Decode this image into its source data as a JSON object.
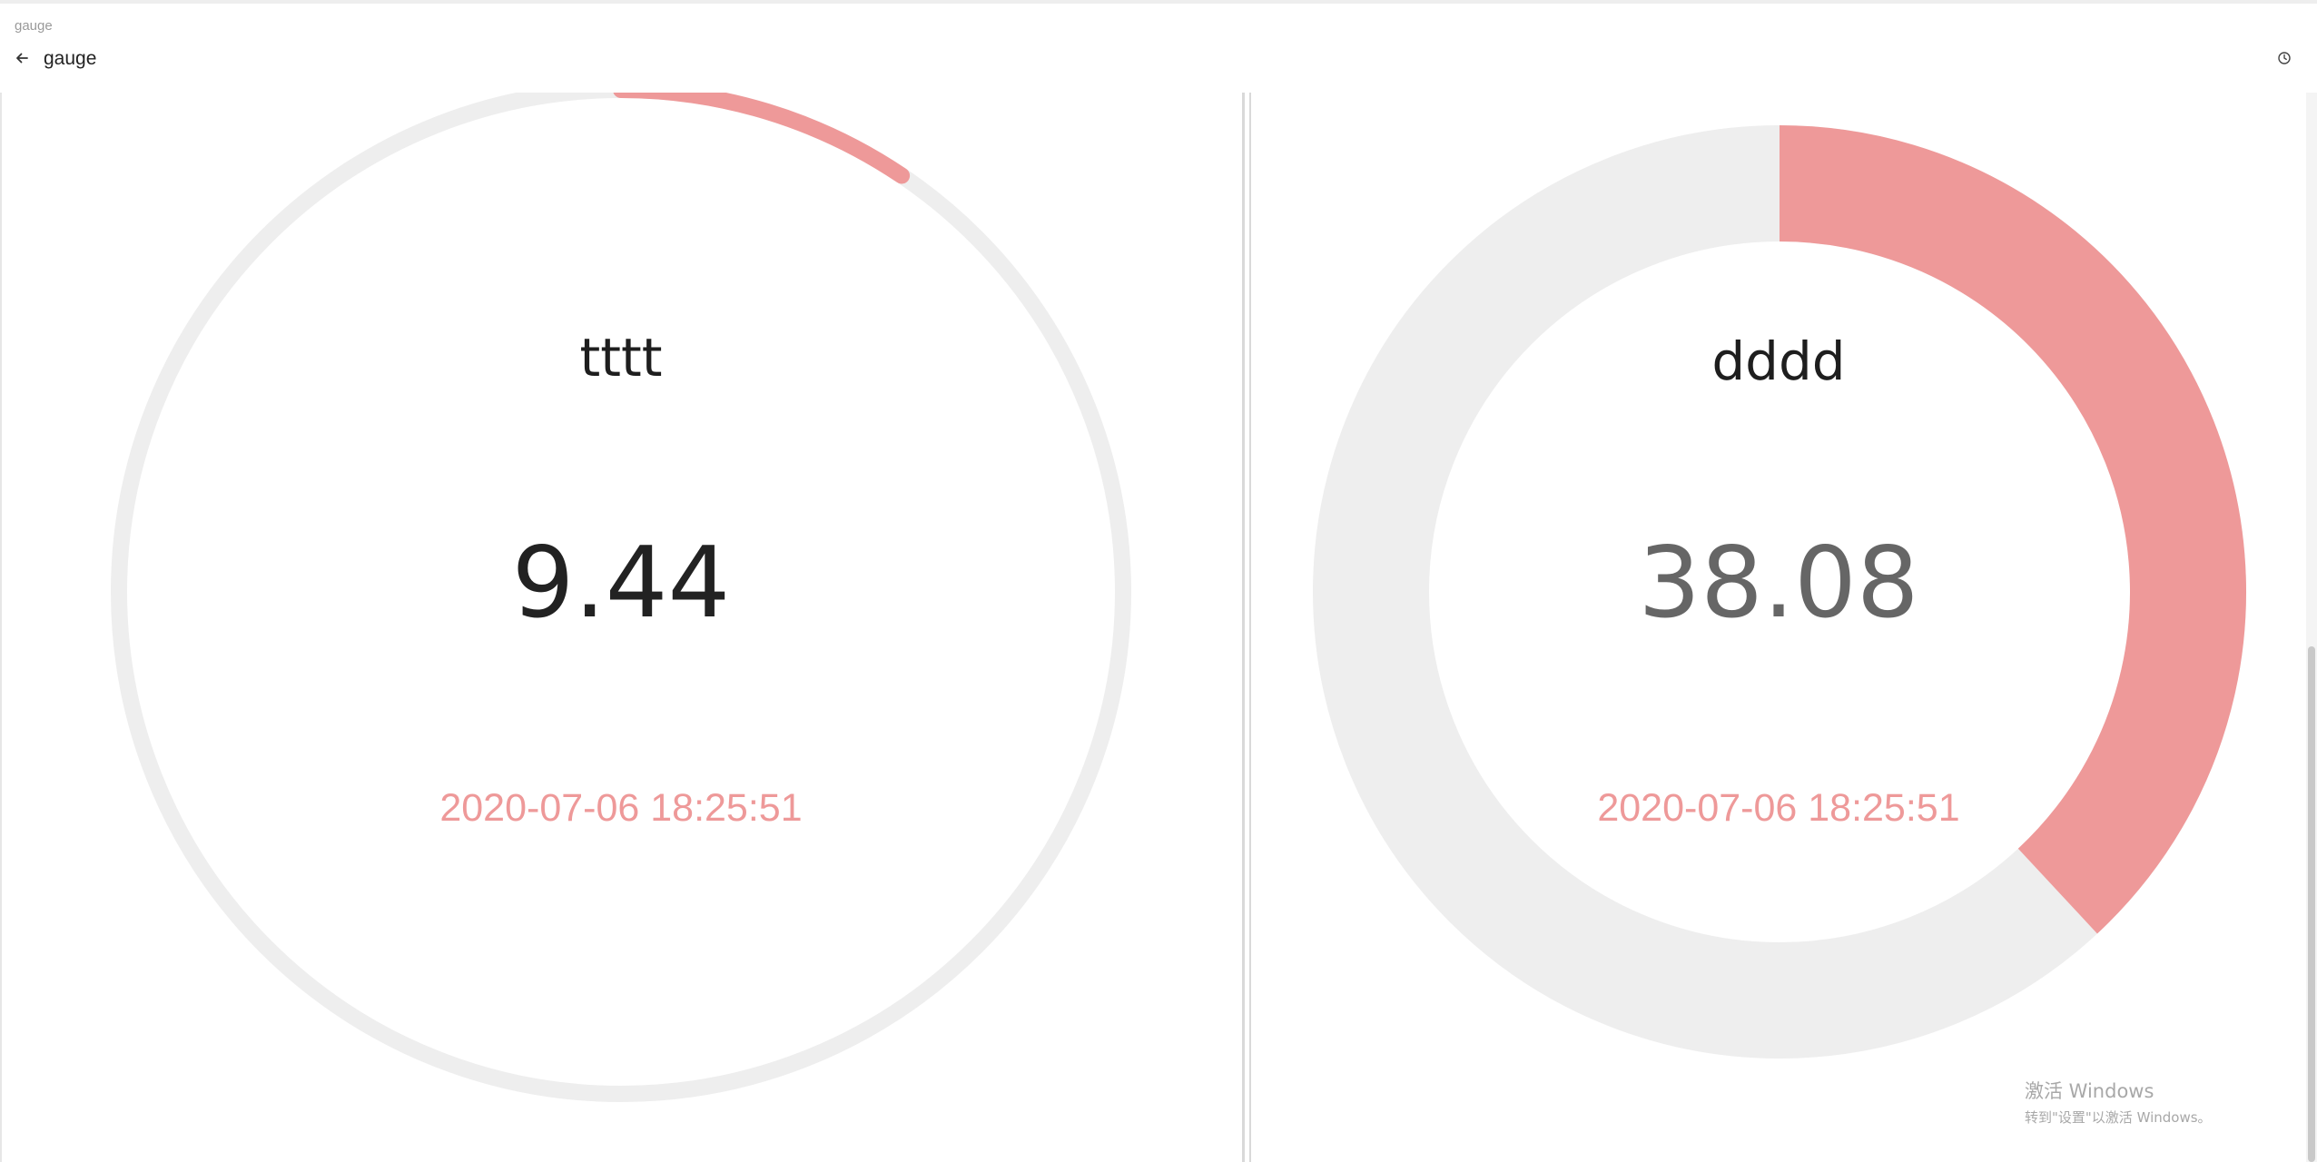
{
  "window": {
    "tab_caption": "gauge",
    "title": "gauge"
  },
  "icons": {
    "back": "arrow-left-icon",
    "history": "clock-icon"
  },
  "gauges": [
    {
      "name": "tttt",
      "value": "9.44",
      "timestamp": "2020-07-06 18:25:51",
      "max": 100,
      "fraction": 0.0944,
      "style": "thin-ring",
      "value_color": "#222222"
    },
    {
      "name": "dddd",
      "value": "38.08",
      "timestamp": "2020-07-06 18:25:51",
      "max": 100,
      "fraction": 0.3808,
      "style": "thick-ring",
      "value_color": "#666666"
    }
  ],
  "colors": {
    "accent": "#ee9999",
    "track": "#eeeeee"
  },
  "watermark": {
    "title": "激活 Windows",
    "subtitle": "转到\"设置\"以激活 Windows。"
  }
}
